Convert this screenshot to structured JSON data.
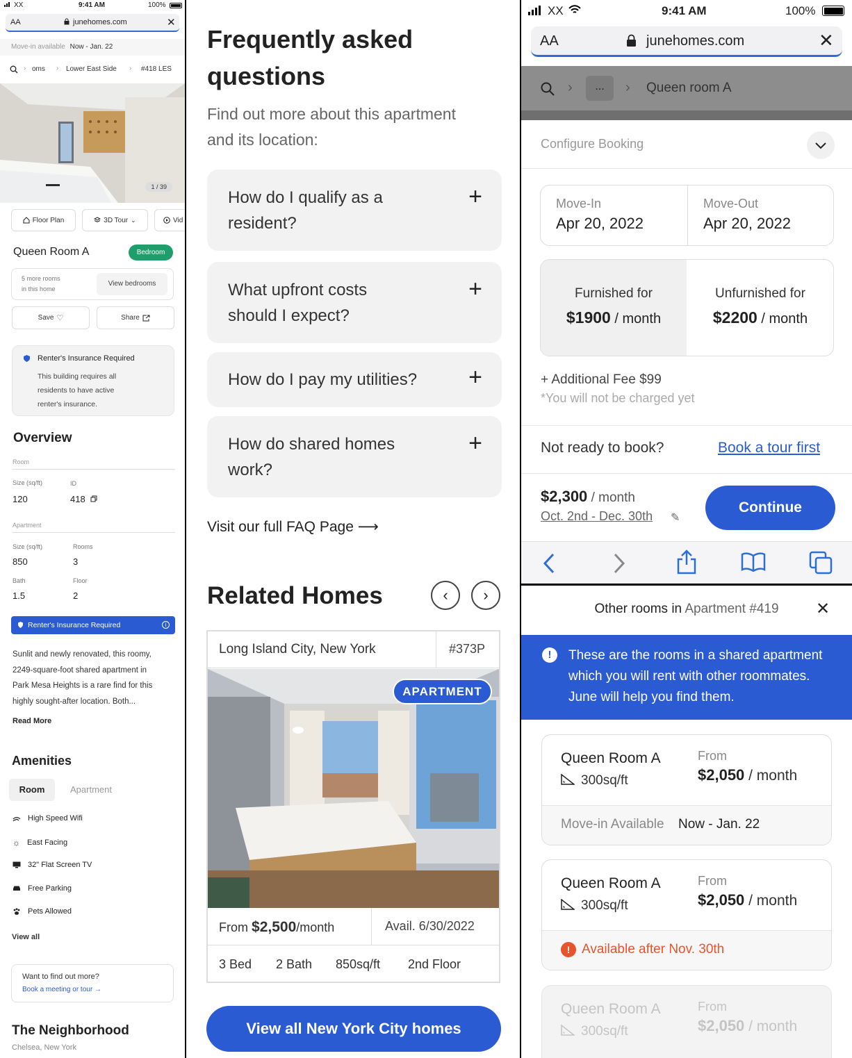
{
  "colors": {
    "brand_blue": "#2b5bd2",
    "accent_green": "#1e9e6a",
    "warning_red": "#e8542c",
    "url_underline": "#2f6bd9"
  },
  "panel1": {
    "status": {
      "carrier": "XX",
      "time": "9:41 AM",
      "battery": "100%"
    },
    "url": {
      "aa": "AA",
      "domain": "junehomes.com"
    },
    "move_in": {
      "label": "Move-in available",
      "value": "Now - Jan. 22"
    },
    "breadcrumb": [
      "oms",
      "Lower East Side",
      "#418 LES"
    ],
    "photo_counter": "1 / 39",
    "view_buttons": [
      "Floor Plan",
      "3D Tour",
      "Vid"
    ],
    "room_title": "Queen Room A",
    "room_badge": "Bedroom",
    "more_rooms": {
      "line1": "5 more rooms",
      "line2": "in this home",
      "button": "View bedrooms"
    },
    "save_label": "Save",
    "share_label": "Share",
    "insurance_card": {
      "title": "Renter's Insurance Required",
      "body_line1": "This building requires all",
      "body_line2": "residents to have active",
      "body_line3": "renter's insurance."
    },
    "overview": {
      "title": "Overview",
      "room_label": "Room",
      "room_size_label": "Size (sq/ft)",
      "room_size": "120",
      "id_label": "ID",
      "id_value": "418",
      "apartment_label": "Apartment",
      "apt_size_label": "Size (sq/ft)",
      "apt_size": "850",
      "rooms_label": "Rooms",
      "rooms": "3",
      "bath_label": "Bath",
      "bath": "1.5",
      "floor_label": "Floor",
      "floor": "2"
    },
    "insurance_bar": "Renter's Insurance Required",
    "description": [
      "Sunlit and newly renovated, this roomy,",
      "2249-square-foot shared apartment in",
      "Park Mesa Heights is a rare find for this",
      "highly sought-after location. Both..."
    ],
    "read_more": "Read More",
    "amenities": {
      "title": "Amenities",
      "tab_room": "Room",
      "tab_apartment": "Apartment",
      "items": [
        "High Speed Wifi",
        "East Facing",
        "32\" Flat Screen TV",
        "Free Parking",
        "Pets Allowed"
      ],
      "view_all": "View all"
    },
    "find_more": {
      "title": "Want to find out more?",
      "link": "Book a meeting or tour"
    },
    "neighborhood": {
      "title": "The Neighborhood",
      "subtitle": "Chelsea, New York"
    }
  },
  "panel2": {
    "faq_title_1": "Frequently asked",
    "faq_title_2": "questions",
    "faq_sub_1": "Find out more about this apartment",
    "faq_sub_2": "and its location:",
    "faq": [
      {
        "line1": "How do I qualify as a",
        "line2": "resident?"
      },
      {
        "line1": "What upfront costs",
        "line2": "should I expect?"
      },
      {
        "line1": "How do I pay my utilities?",
        "line2": ""
      },
      {
        "line1": "How do shared homes",
        "line2": "work?"
      }
    ],
    "faq_link": "Visit our full FAQ Page",
    "related_title": "Related Homes",
    "listing": {
      "location": "Long Island City, New York",
      "unit": "#373P",
      "badge": "APARTMENT",
      "price_prefix": "From",
      "price": "$2,500",
      "price_unit": "/month",
      "avail": "Avail. 6/30/2022",
      "beds": "3 Bed",
      "baths": "2 Bath",
      "size": "850sq/ft",
      "floor": "2nd Floor"
    },
    "view_all_button": "View all New York City homes"
  },
  "panel3": {
    "status": {
      "carrier": "XX",
      "time": "9:41 AM",
      "battery": "100%"
    },
    "url": {
      "aa": "AA",
      "domain": "junehomes.com"
    },
    "crumb_ellipsis": "...",
    "crumb_current": "Queen room A",
    "configure": "Configure Booking",
    "move_in_label": "Move-In",
    "move_in_date": "Apr 20, 2022",
    "move_out_label": "Move-Out",
    "move_out_date": "Apr 20, 2022",
    "furnished_label": "Furnished for",
    "furnished_price": "$1900",
    "furnished_unit": "/ month",
    "unfurnished_label": "Unfurnished for",
    "unfurnished_price": "$2200",
    "unfurnished_unit": "/ month",
    "fee": "+ Additional Fee $99",
    "fee_note": "*You will not be charged yet",
    "not_ready": "Not ready to book?",
    "tour_link": "Book a tour first",
    "total_price": "$2,300",
    "total_unit": "/ month",
    "total_dates": "Oct. 2nd - Dec. 30th",
    "continue": "Continue"
  },
  "panel4": {
    "header_prefix": "Other rooms in",
    "header_apartment": "Apartment #419",
    "info_line1": "These are the rooms in a shared apartment",
    "info_line2": "which you will rent with other roommates.",
    "info_line3": "June will help you find them.",
    "rooms": [
      {
        "name": "Queen Room A",
        "size": "300sq/ft",
        "from": "From",
        "price": "$2,050",
        "unit": "/ month",
        "status_label": "Move-in Available",
        "status_value": "Now - Jan. 22"
      },
      {
        "name": "Queen Room A",
        "size": "300sq/ft",
        "from": "From",
        "price": "$2,050",
        "unit": "/ month",
        "status_label": "Available after Nov. 30th"
      },
      {
        "name": "Queen Room A",
        "size": "300sq/ft",
        "from": "From",
        "price": "$2,050",
        "unit": "/ month"
      }
    ]
  }
}
